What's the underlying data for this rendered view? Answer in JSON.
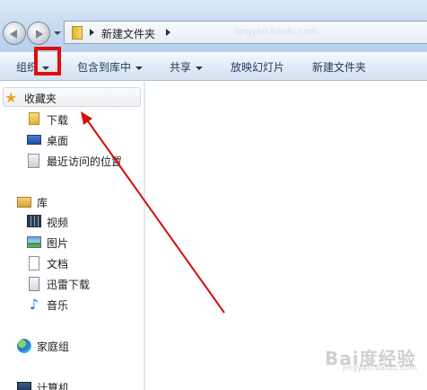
{
  "address_bar": {
    "path": [
      "新建文件夹"
    ],
    "faded_text": "lingyan.baidu.com"
  },
  "toolbar": {
    "organize": "组织",
    "include_in_library": "包含到库中",
    "share": "共享",
    "slideshow": "放映幻灯片",
    "new_folder": "新建文件夹"
  },
  "nav_pane": {
    "favorites": {
      "header": "收藏夹",
      "items": [
        {
          "label": "下载",
          "icon": "download-folder-icon"
        },
        {
          "label": "桌面",
          "icon": "desktop-icon"
        },
        {
          "label": "最近访问的位置",
          "icon": "recent-places-icon"
        }
      ]
    },
    "libraries": {
      "header": "库",
      "items": [
        {
          "label": "视频",
          "icon": "video-library-icon"
        },
        {
          "label": "图片",
          "icon": "pictures-library-icon"
        },
        {
          "label": "文档",
          "icon": "documents-library-icon"
        },
        {
          "label": "迅雷下载",
          "icon": "thunder-download-icon"
        },
        {
          "label": "音乐",
          "icon": "music-library-icon"
        }
      ]
    },
    "homegroup": "家庭组",
    "computer": "计算机"
  },
  "annotation": {
    "highlight_color": "#e00d0d",
    "arrow_color": "#d40f0f"
  },
  "watermark": {
    "main": "Bai度经验",
    "sub": "jingyan.baidu.com"
  }
}
